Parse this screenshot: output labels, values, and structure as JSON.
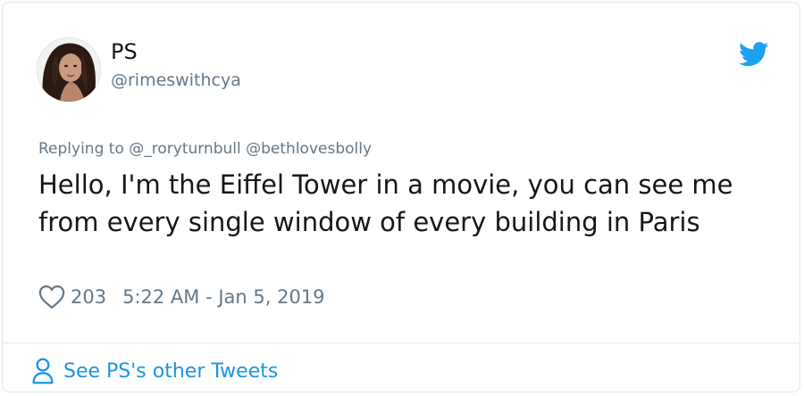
{
  "user": {
    "display_name": "PS",
    "handle": "@rimeswithcya"
  },
  "tweet": {
    "reply_prefix": "Replying to",
    "reply_mentions": "@_roryturnbull @bethlovesbolly",
    "text": "Hello, I'm the Eiffel Tower in a movie, you can see me from every single window of every building in Paris",
    "like_count": "203",
    "timestamp": "5:22 AM - Jan 5, 2019"
  },
  "footer": {
    "link_label": "See PS's other Tweets"
  },
  "icons": {
    "brand": "twitter-bird-icon",
    "like": "heart-outline-icon",
    "profile": "person-outline-icon"
  },
  "colors": {
    "brand_blue": "#1da1f2",
    "link_blue": "#1b95e0",
    "secondary_text": "#657786",
    "primary_text": "#14171a",
    "border": "#e1e8ed"
  }
}
